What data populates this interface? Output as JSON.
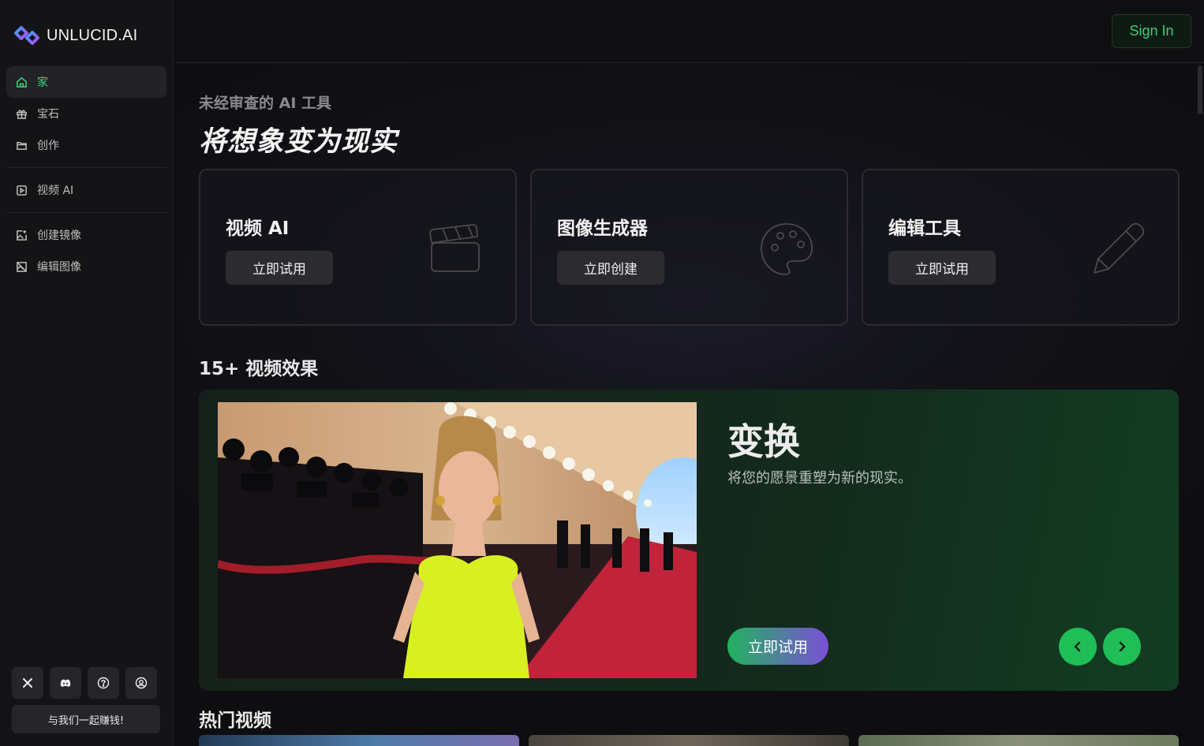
{
  "brand": {
    "name": "UNLUCID.AI"
  },
  "header": {
    "signin_label": "Sign In"
  },
  "sidebar": {
    "items": [
      {
        "label": "家",
        "icon": "home-icon"
      },
      {
        "label": "宝石",
        "icon": "gift-icon"
      },
      {
        "label": "创作",
        "icon": "folder-icon"
      },
      {
        "label": "视频 AI",
        "icon": "video-icon"
      },
      {
        "label": "创建镜像",
        "icon": "image-plus-icon"
      },
      {
        "label": "编辑图像",
        "icon": "image-edit-icon"
      }
    ],
    "social": [
      "x-icon",
      "discord-icon",
      "help-icon",
      "account-icon"
    ],
    "earn_label": "与我们一起赚钱!"
  },
  "hero": {
    "subtitle": "未经审查的 AI 工具",
    "headline": "将想象变为现实"
  },
  "tools": [
    {
      "title": "视频 AI",
      "button": "立即试用",
      "icon": "clapperboard-icon"
    },
    {
      "title": "图像生成器",
      "button": "立即创建",
      "icon": "palette-icon"
    },
    {
      "title": "编辑工具",
      "button": "立即试用",
      "icon": "pencil-icon"
    }
  ],
  "effects": {
    "section_title": "15+ 视频效果",
    "title": "变换",
    "description": "将您的愿景重塑为新的现实。",
    "button": "立即试用"
  },
  "popular": {
    "section_title": "热门视频"
  },
  "colors": {
    "accent": "#33d17a",
    "background": "#0d0d0f"
  }
}
